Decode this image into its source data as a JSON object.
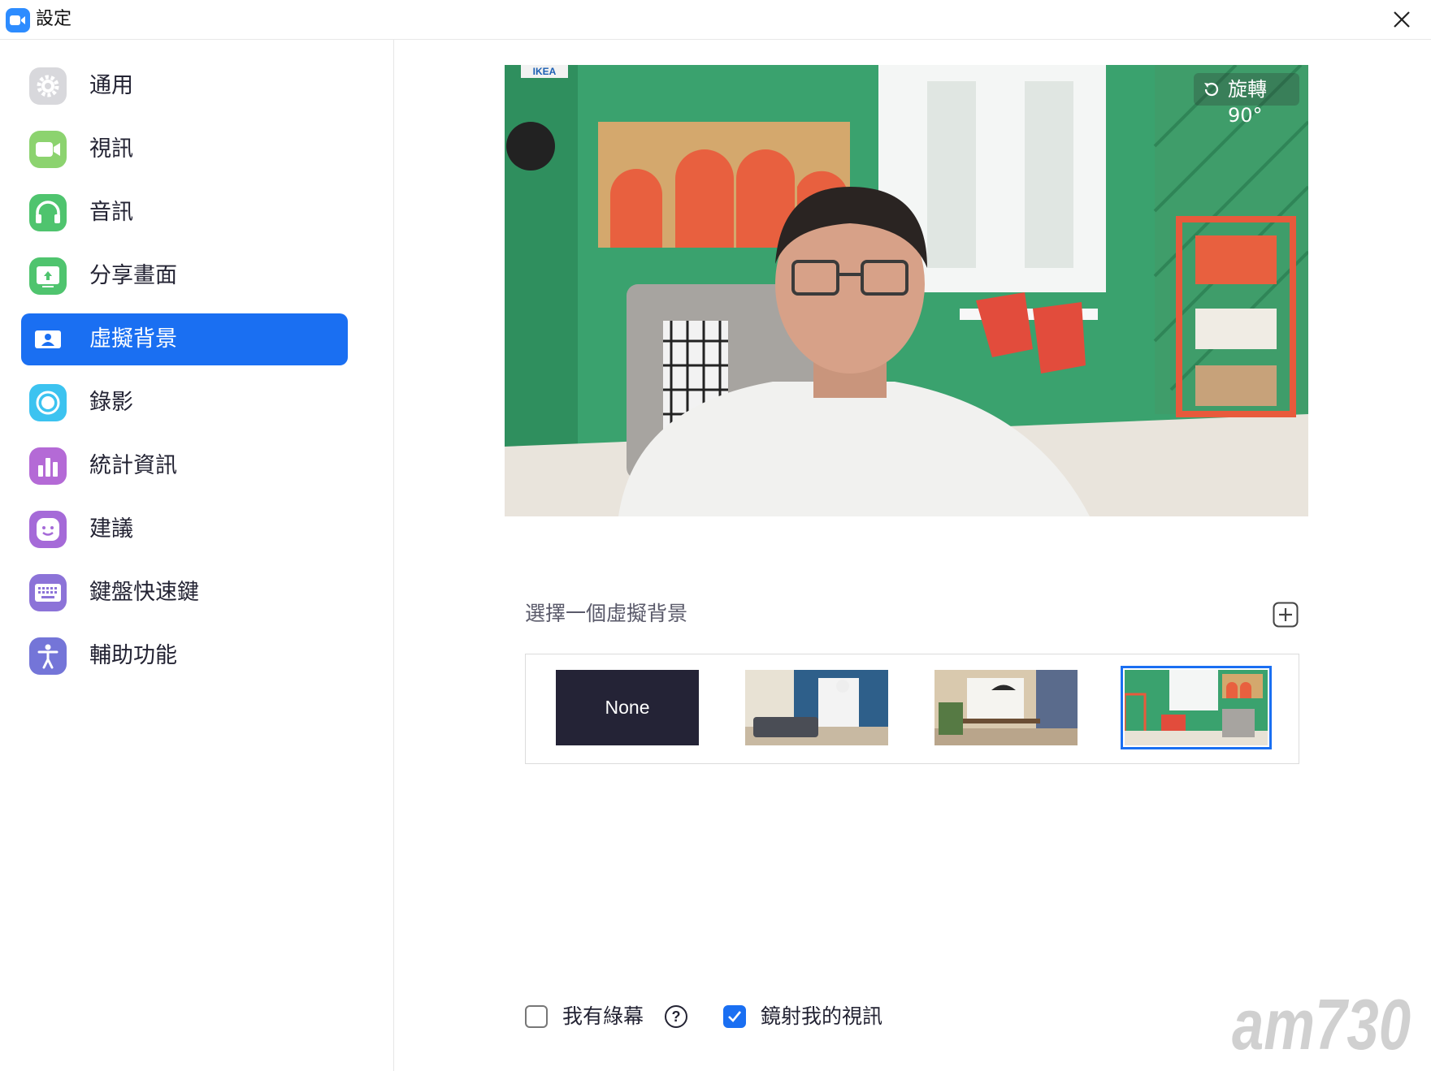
{
  "window": {
    "title": "設定"
  },
  "sidebar": {
    "items": [
      {
        "label": "通用",
        "icon": "gear-icon",
        "color": "#d8d8dc"
      },
      {
        "label": "視訊",
        "icon": "video-camera-icon",
        "color": "#8cd36f"
      },
      {
        "label": "音訊",
        "icon": "headphones-icon",
        "color": "#4fc46e"
      },
      {
        "label": "分享畫面",
        "icon": "share-screen-icon",
        "color": "#4fc46e"
      },
      {
        "label": "虛擬背景",
        "icon": "virtual-background-icon",
        "color": "#ffffff",
        "active": true
      },
      {
        "label": "錄影",
        "icon": "record-icon",
        "color": "#3cc3f0"
      },
      {
        "label": "統計資訊",
        "icon": "statistics-icon",
        "color": "#b46ad6"
      },
      {
        "label": "建議",
        "icon": "feedback-icon",
        "color": "#a56ad8"
      },
      {
        "label": "鍵盤快速鍵",
        "icon": "keyboard-icon",
        "color": "#8c73d8"
      },
      {
        "label": "輔助功能",
        "icon": "accessibility-icon",
        "color": "#7475d8"
      }
    ]
  },
  "preview": {
    "rotate_label": "旋轉90°",
    "sign_text": "IKEA"
  },
  "background_picker": {
    "label": "選擇一個虛擬背景",
    "add_icon": "plus-icon",
    "thumbnails": [
      {
        "label": "None",
        "selected": false
      },
      {
        "label": "",
        "selected": false
      },
      {
        "label": "",
        "selected": false
      },
      {
        "label": "",
        "selected": true
      }
    ]
  },
  "options": {
    "green_screen": {
      "label": "我有綠幕",
      "checked": false,
      "help_icon": "?"
    },
    "mirror_video": {
      "label": "鏡射我的視訊",
      "checked": true
    }
  },
  "watermark": {
    "text": "am730"
  },
  "colors": {
    "accent": "#1a6ff2",
    "brand": "#2d8cff"
  }
}
